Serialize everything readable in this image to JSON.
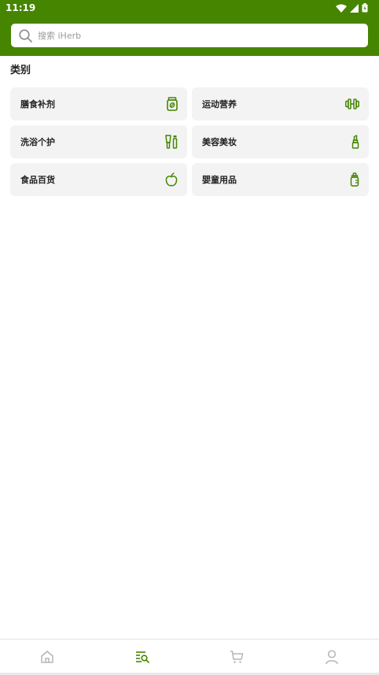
{
  "status_bar": {
    "time": "11:19"
  },
  "search": {
    "placeholder": "搜索 iHerb"
  },
  "section": {
    "title": "类别"
  },
  "categories": [
    {
      "label": "膳食补剂",
      "icon": "supplement-jar-icon"
    },
    {
      "label": "运动营养",
      "icon": "dumbbell-icon"
    },
    {
      "label": "洗浴个护",
      "icon": "bath-products-icon"
    },
    {
      "label": "美容美妆",
      "icon": "lipstick-icon"
    },
    {
      "label": "食品百货",
      "icon": "apple-icon"
    },
    {
      "label": "婴童用品",
      "icon": "baby-bottle-icon"
    }
  ],
  "bottom_nav": [
    {
      "name": "home",
      "icon": "home-icon",
      "active": false
    },
    {
      "name": "categories",
      "icon": "category-search-icon",
      "active": true
    },
    {
      "name": "cart",
      "icon": "cart-icon",
      "active": false
    },
    {
      "name": "account",
      "icon": "user-icon",
      "active": false
    }
  ],
  "colors": {
    "brand": "#458500",
    "card_bg": "#f3f3f3",
    "inactive_icon": "#b5b5b5"
  }
}
